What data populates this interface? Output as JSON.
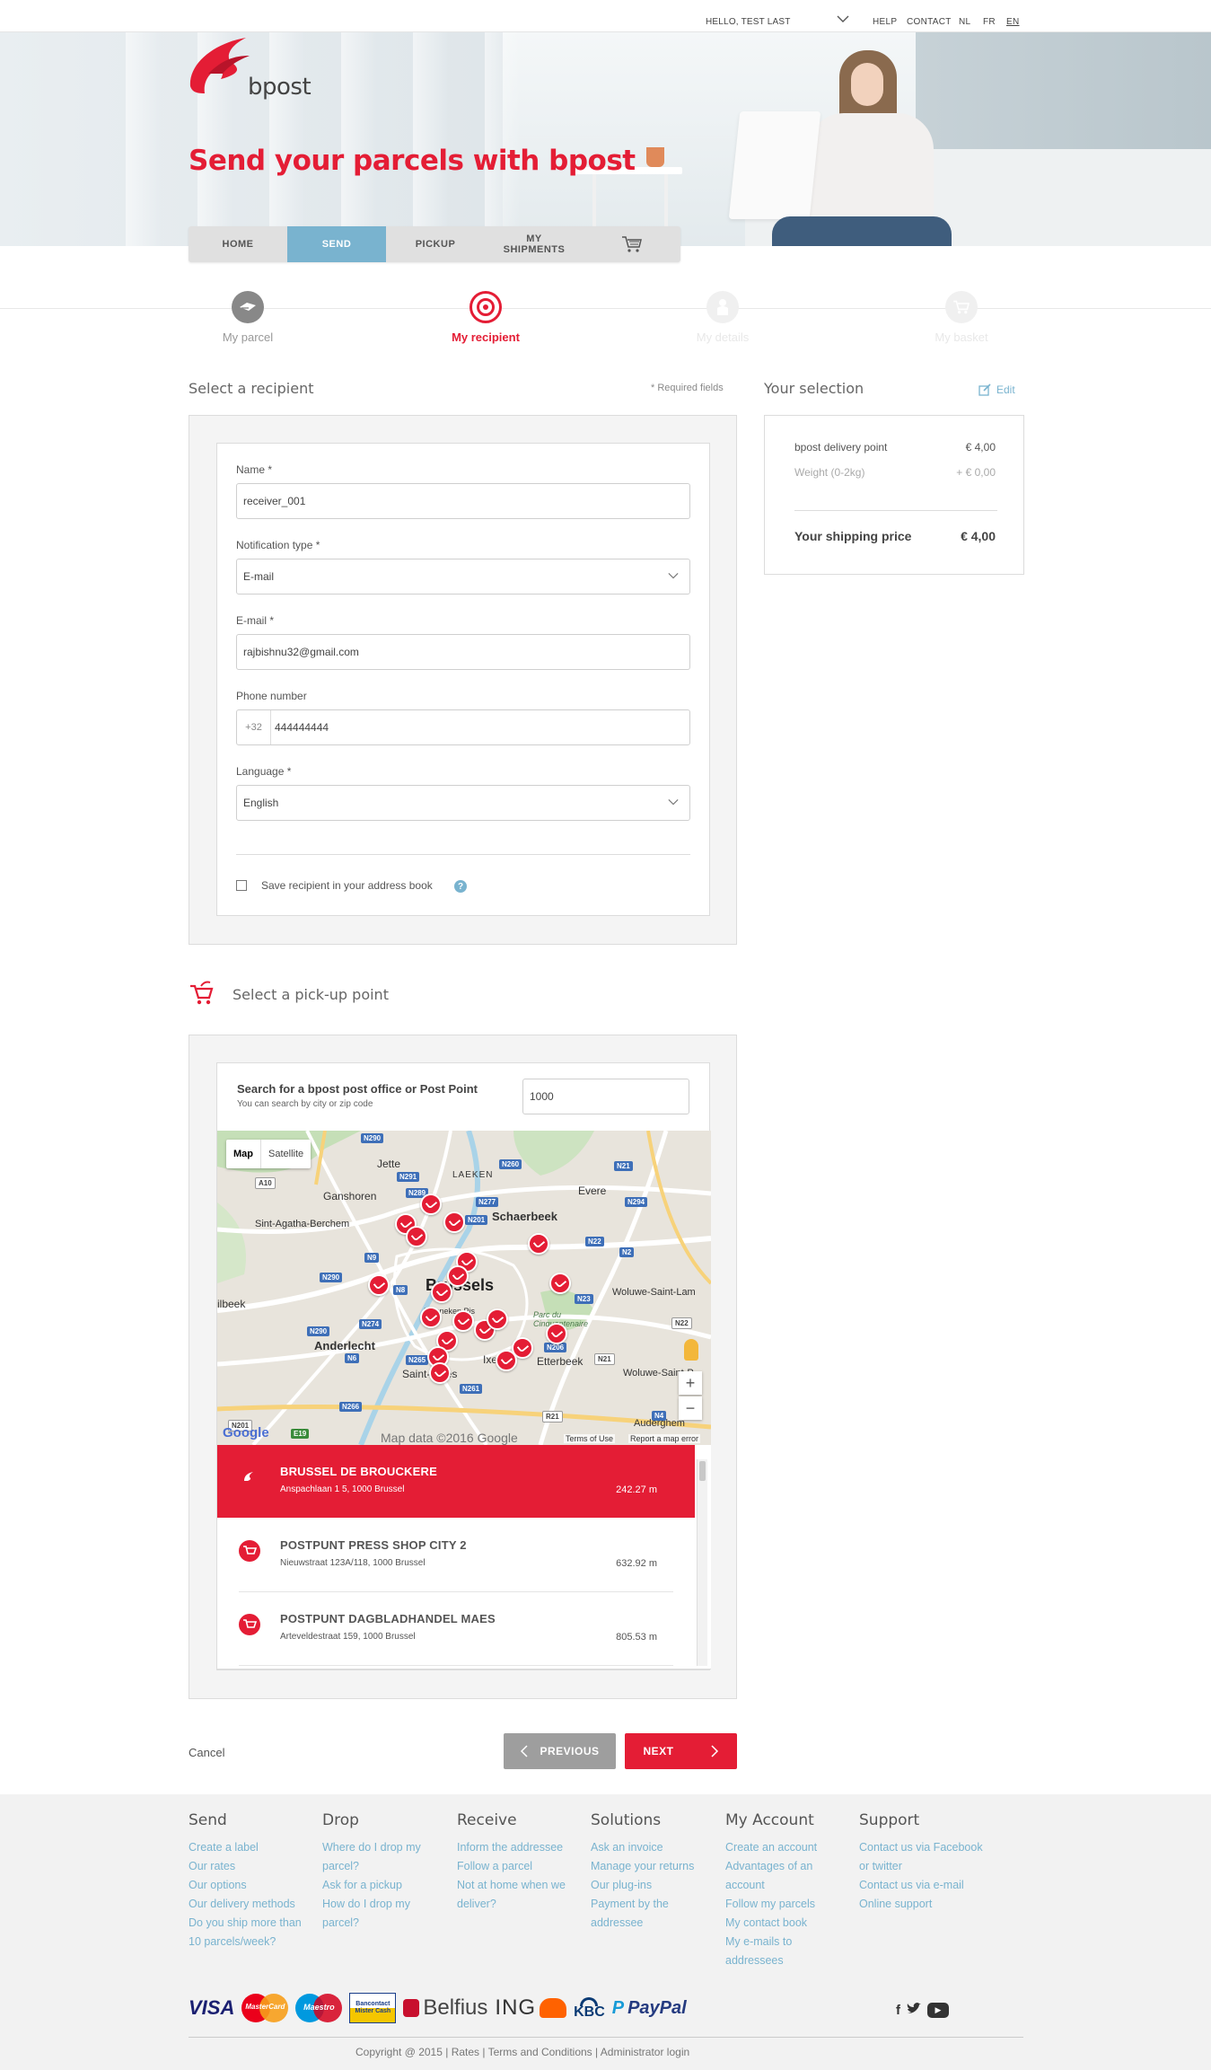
{
  "topbar": {
    "greeting": "HELLO, TEST LAST",
    "links": [
      "HELP",
      "CONTACT",
      "NL",
      "FR",
      "EN"
    ]
  },
  "hero": {
    "logo_text": "bpost",
    "title": "Send your parcels with bpost"
  },
  "nav": {
    "items": [
      {
        "label": "HOME",
        "active": false
      },
      {
        "label": "SEND",
        "active": true
      },
      {
        "label": "PICKUP",
        "active": false
      },
      {
        "label": "MY\nSHIPMENTS",
        "active": false
      }
    ],
    "cart_icon": "basket-icon"
  },
  "steps": [
    {
      "label": "My parcel",
      "state": "done",
      "icon": "parcel-icon"
    },
    {
      "label": "My recipient",
      "state": "active",
      "icon": "target-icon"
    },
    {
      "label": "My details",
      "state": "todo",
      "icon": "person-icon"
    },
    {
      "label": "My basket",
      "state": "todo",
      "icon": "basket-icon"
    }
  ],
  "recipient": {
    "title": "Select a recipient",
    "required_note": "* Required fields",
    "name_label": "Name *",
    "name_value": "receiver_001",
    "notif_label": "Notification type *",
    "notif_value": "E-mail",
    "email_label": "E-mail *",
    "email_value": "rajbishnu32@gmail.com",
    "phone_label": "Phone number",
    "phone_prefix": "+32",
    "phone_value": "444444444",
    "lang_label": "Language *",
    "lang_value": "English",
    "save_label": "Save recipient in your address book",
    "info": "?"
  },
  "selection": {
    "title": "Your selection",
    "edit": "Edit",
    "rows": [
      {
        "label": "bpost delivery point",
        "value": "€ 4,00"
      },
      {
        "label": "Weight (0-2kg)",
        "value": "+ € 0,00"
      }
    ],
    "total_label": "Your shipping price",
    "total_value": "€ 4,00"
  },
  "pickup": {
    "title": "Select a pick-up point",
    "search_title": "Search for a bpost post office or Post Point",
    "search_sub": "You can search by city or zip code",
    "search_value": "1000",
    "map": {
      "tab_map": "Map",
      "tab_sat": "Satellite",
      "labels": [
        "Jette",
        "LAEKEN",
        "Ganshoren",
        "Evere",
        "Schaerbeek",
        "Sint-Agatha-Berchem",
        "Brussels",
        "Woluwe-Saint-Lam",
        "Anderlecht",
        "Etterbeek",
        "Woluwe-Saint-P",
        "Ixelles",
        "Saint-Gilles",
        "Auderghem",
        "ilbeek",
        "Parc du Cinquantenaire",
        "Manneken Pis"
      ],
      "roads": [
        "N290",
        "N291",
        "N260",
        "N21",
        "A10",
        "N289",
        "N277",
        "N294",
        "N201",
        "N22",
        "N2",
        "N9",
        "N290",
        "N8",
        "N23",
        "N274",
        "N290",
        "N22",
        "N6",
        "N265",
        "N206",
        "N21",
        "N261",
        "N266",
        "R21",
        "N4",
        "E19",
        "N201"
      ],
      "attribution": "Map data ©2016 Google",
      "terms": "Terms of Use",
      "report": "Report a map error",
      "google": "Google",
      "zoom_in": "+",
      "zoom_out": "−"
    },
    "points": [
      {
        "name": "BRUSSEL DE BROUCKERE",
        "address": "Anspachlaan 1 5, 1000 Brussel",
        "distance": "242.27 m",
        "selected": true
      },
      {
        "name": "POSTPUNT PRESS SHOP CITY 2",
        "address": "Nieuwstraat 123A/118, 1000 Brussel",
        "distance": "632.92 m",
        "selected": false
      },
      {
        "name": "POSTPUNT DAGBLADHANDEL MAES",
        "address": "Arteveldestraat 159, 1000 Brussel",
        "distance": "805.53 m",
        "selected": false
      }
    ]
  },
  "actions": {
    "cancel": "Cancel",
    "previous": "PREVIOUS",
    "next": "NEXT"
  },
  "footer": {
    "columns": [
      {
        "title": "Send",
        "links": [
          "Create a label",
          "Our rates",
          "Our options",
          "Our delivery methods",
          "Do you ship more than 10 parcels/week?"
        ]
      },
      {
        "title": "Drop",
        "links": [
          "Where do I drop my parcel?",
          "Ask for a pickup",
          "How do I drop my parcel?"
        ]
      },
      {
        "title": "Receive",
        "links": [
          "Inform the addressee",
          "Follow a parcel",
          "Not at home when we deliver?"
        ]
      },
      {
        "title": "Solutions",
        "links": [
          "Ask an invoice",
          "Manage your returns",
          "Our plug-ins",
          "Payment by the addressee"
        ]
      },
      {
        "title": "My Account",
        "links": [
          "Create an account",
          "Advantages of an account",
          "Follow my parcels",
          "My contact book",
          "My e-mails to addressees"
        ]
      },
      {
        "title": "Support",
        "links": [
          "Contact us via Facebook or twitter",
          "Contact us via e-mail",
          "Online support"
        ]
      }
    ],
    "payments": [
      "VISA",
      "MasterCard",
      "Maestro",
      "Bancontact Mister Cash",
      "Belfius",
      "ING",
      "KBC",
      "PayPal"
    ],
    "social": [
      "f",
      "t",
      "▶"
    ],
    "copyright": "Copyright @  2015   |  Rates | Terms and Conditions |  Administrator login"
  },
  "colors": {
    "brand_red": "#e41d35",
    "accent_blue": "#79b3cf"
  }
}
